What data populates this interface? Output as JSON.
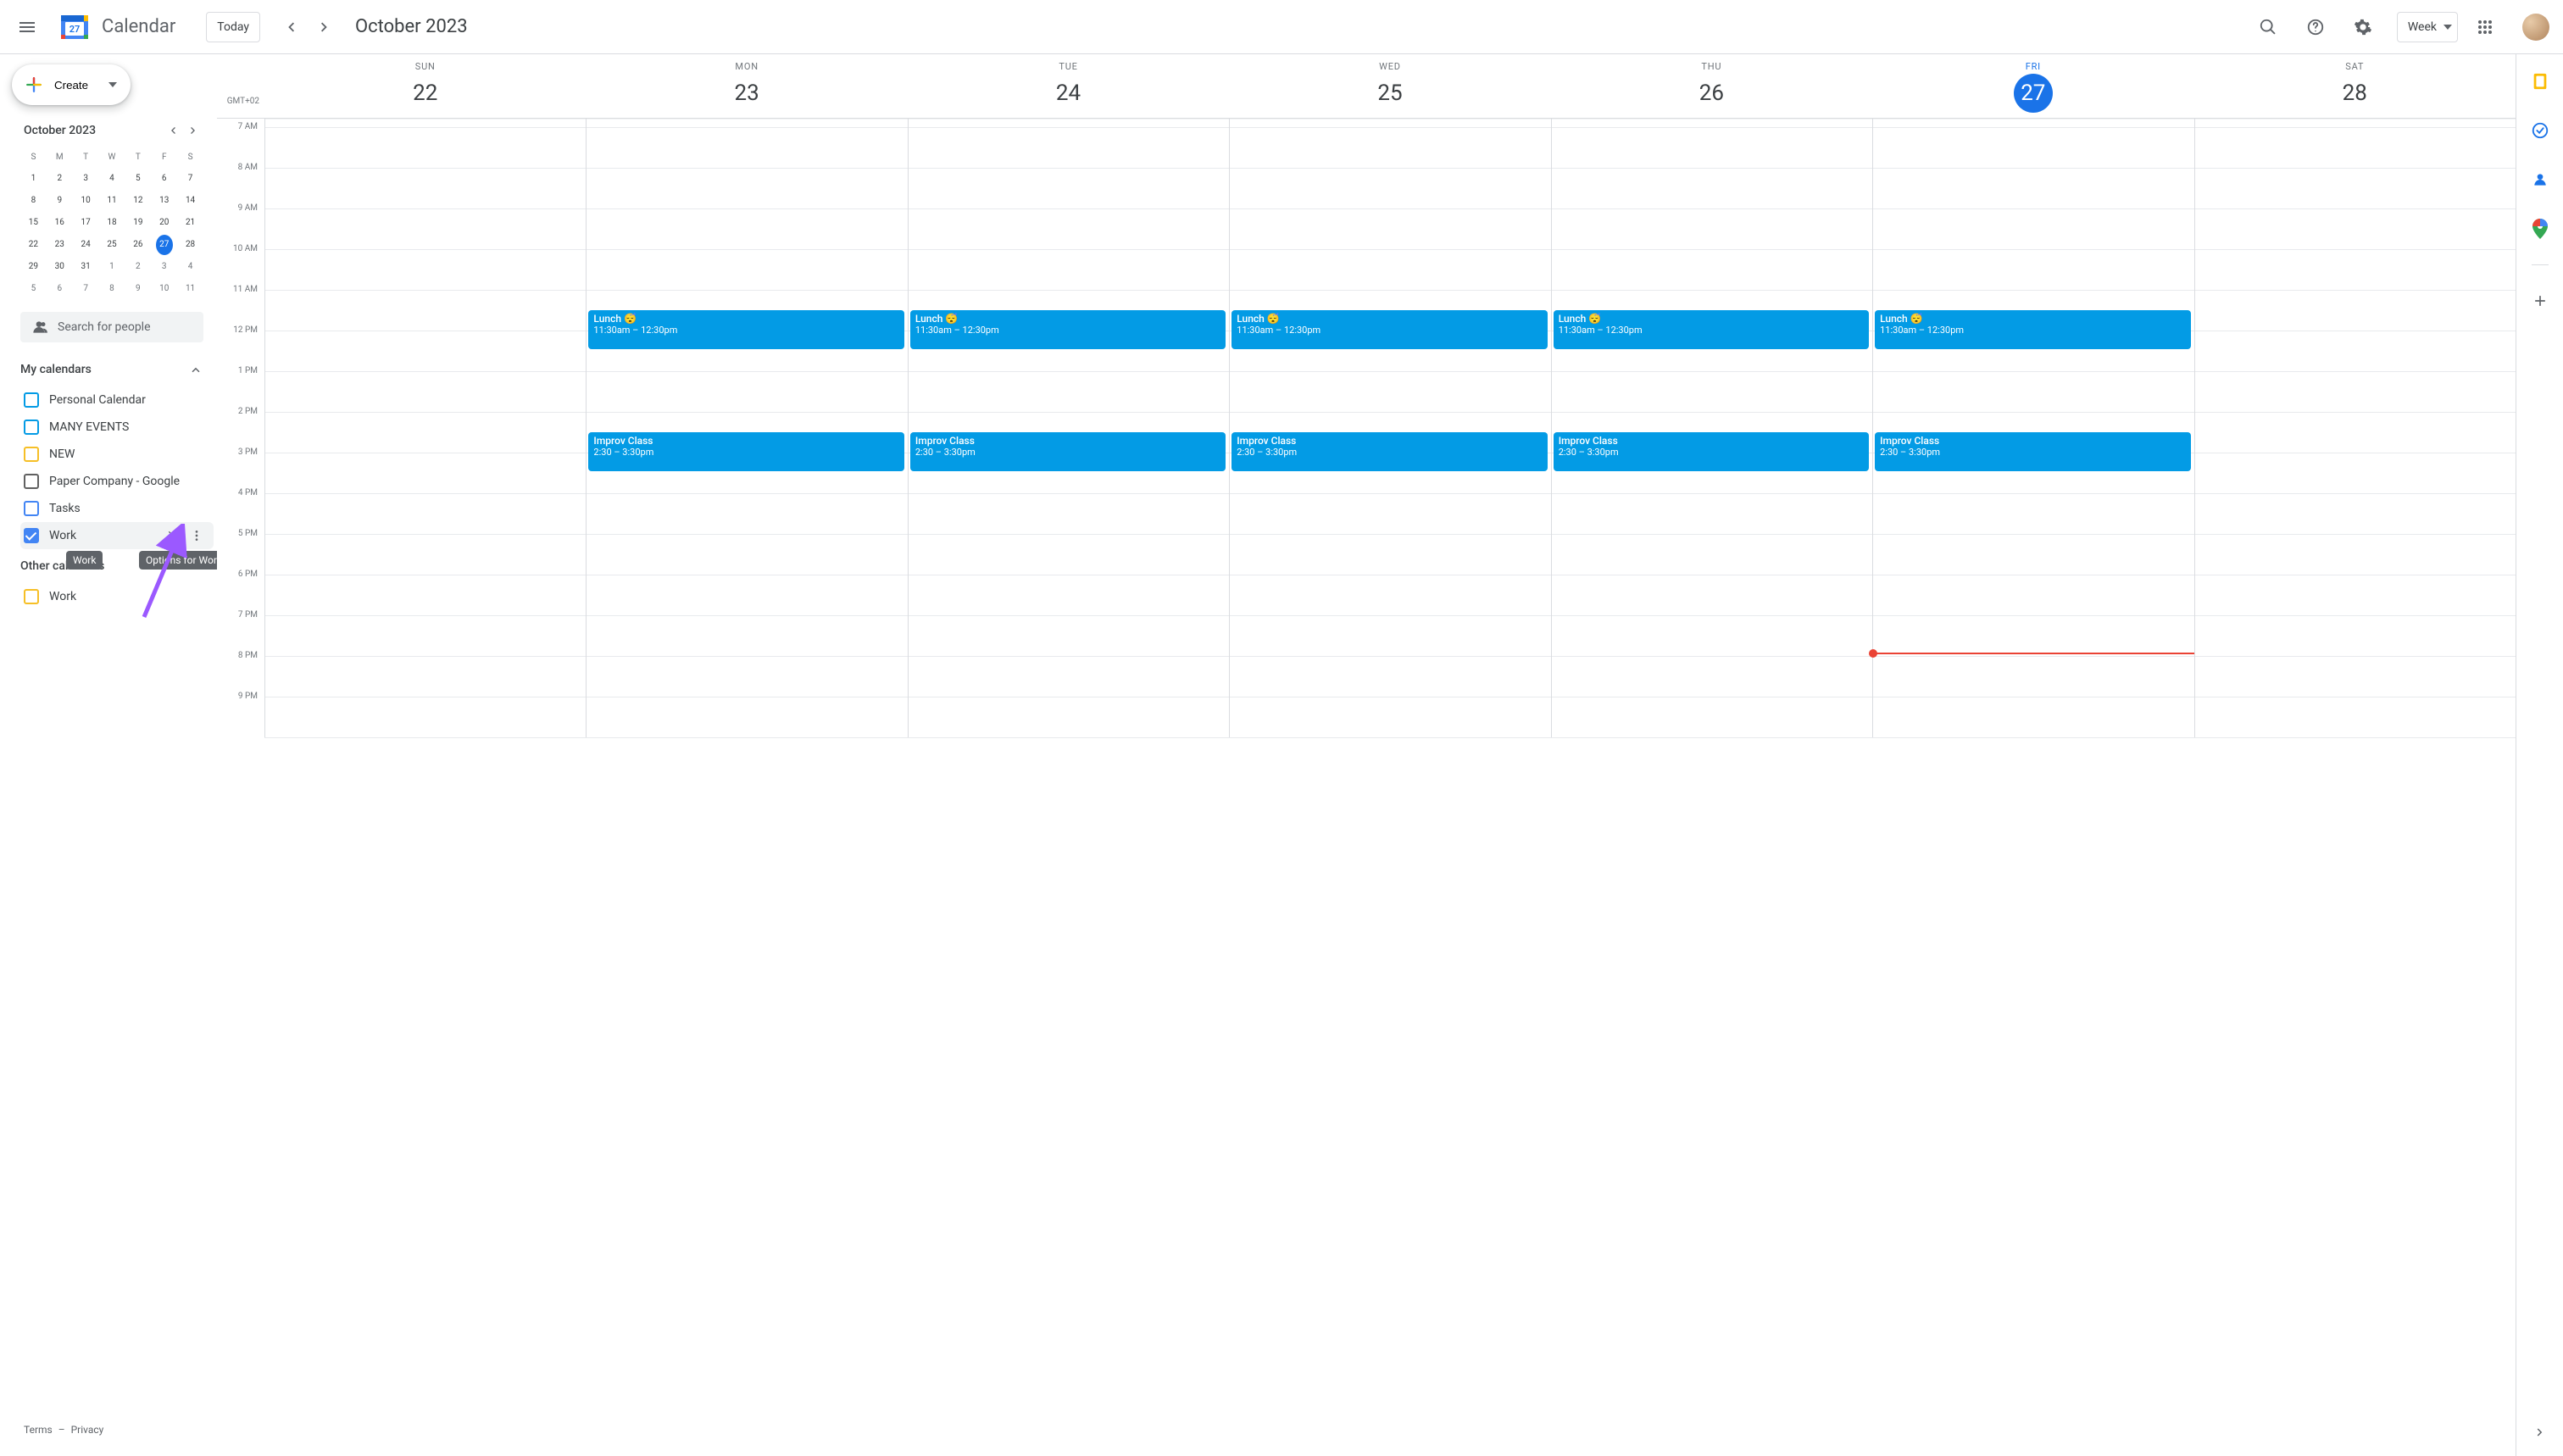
{
  "header": {
    "app_title": "Calendar",
    "today_label": "Today",
    "period_title": "October 2023",
    "view_label": "Week"
  },
  "create_label": "Create",
  "mini_cal": {
    "title": "October 2023",
    "dows": [
      "S",
      "M",
      "T",
      "W",
      "T",
      "F",
      "S"
    ],
    "weeks": [
      [
        {
          "n": 1
        },
        {
          "n": 2
        },
        {
          "n": 3
        },
        {
          "n": 4
        },
        {
          "n": 5
        },
        {
          "n": 6
        },
        {
          "n": 7
        }
      ],
      [
        {
          "n": 8
        },
        {
          "n": 9
        },
        {
          "n": 10
        },
        {
          "n": 11
        },
        {
          "n": 12
        },
        {
          "n": 13
        },
        {
          "n": 14
        }
      ],
      [
        {
          "n": 15
        },
        {
          "n": 16
        },
        {
          "n": 17
        },
        {
          "n": 18
        },
        {
          "n": 19
        },
        {
          "n": 20
        },
        {
          "n": 21
        }
      ],
      [
        {
          "n": 22
        },
        {
          "n": 23
        },
        {
          "n": 24
        },
        {
          "n": 25
        },
        {
          "n": 26
        },
        {
          "n": 27,
          "today": true
        },
        {
          "n": 28
        }
      ],
      [
        {
          "n": 29
        },
        {
          "n": 30
        },
        {
          "n": 31
        },
        {
          "n": 1,
          "o": true
        },
        {
          "n": 2,
          "o": true
        },
        {
          "n": 3,
          "o": true
        },
        {
          "n": 4,
          "o": true
        }
      ],
      [
        {
          "n": 5,
          "o": true
        },
        {
          "n": 6,
          "o": true
        },
        {
          "n": 7,
          "o": true
        },
        {
          "n": 8,
          "o": true
        },
        {
          "n": 9,
          "o": true
        },
        {
          "n": 10,
          "o": true
        },
        {
          "n": 11,
          "o": true
        }
      ]
    ]
  },
  "search_placeholder": "Search for people",
  "my_calendars": {
    "title": "My calendars",
    "items": [
      {
        "label": "Personal Calendar",
        "color": "#039be5",
        "checked": false
      },
      {
        "label": "MANY EVENTS",
        "color": "#039be5",
        "checked": false
      },
      {
        "label": "NEW",
        "color": "#f6bf26",
        "checked": false
      },
      {
        "label": "Paper Company - Google",
        "color": "#616161",
        "checked": false
      },
      {
        "label": "Tasks",
        "color": "#4285f4",
        "checked": false
      },
      {
        "label": "Work",
        "color": "#4285f4",
        "checked": true,
        "hover": true
      }
    ]
  },
  "other_calendars": {
    "title": "Other calendars",
    "items": [
      {
        "label": "Work",
        "color": "#f6bf26",
        "checked": false
      }
    ]
  },
  "tooltips": {
    "work_chip": "Work",
    "options": "Options for Work"
  },
  "footer": {
    "terms": "Terms",
    "sep": "–",
    "privacy": "Privacy"
  },
  "timezone": "GMT+02",
  "hours": [
    "7 AM",
    "8 AM",
    "9 AM",
    "10 AM",
    "11 AM",
    "12 PM",
    "1 PM",
    "2 PM",
    "3 PM",
    "4 PM",
    "5 PM",
    "6 PM",
    "7 PM",
    "8 PM",
    "9 PM"
  ],
  "days": [
    {
      "dow": "SUN",
      "num": "22"
    },
    {
      "dow": "MON",
      "num": "23"
    },
    {
      "dow": "TUE",
      "num": "24"
    },
    {
      "dow": "WED",
      "num": "25"
    },
    {
      "dow": "THU",
      "num": "26"
    },
    {
      "dow": "FRI",
      "num": "27",
      "today": true
    },
    {
      "dow": "SAT",
      "num": "28"
    }
  ],
  "events": {
    "lunch": {
      "title": "Lunch 😴",
      "time": "11:30am – 12:30pm",
      "start_hour": 11.5,
      "end_hour": 12.5,
      "days": [
        1,
        2,
        3,
        4,
        5
      ]
    },
    "improv": {
      "title": "Improv Class",
      "time": "2:30 – 3:30pm",
      "start_hour": 14.5,
      "end_hour": 15.5,
      "days": [
        1,
        2,
        3,
        4,
        5
      ]
    }
  },
  "now": {
    "day_index": 5,
    "hour": 19.92
  }
}
